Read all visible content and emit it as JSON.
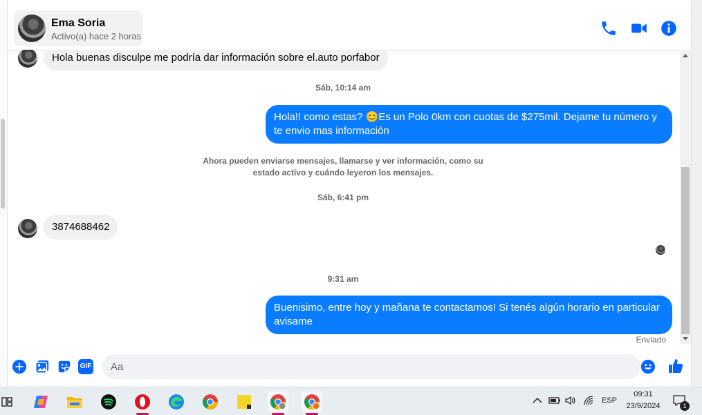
{
  "contact": {
    "name": "Ema Soria",
    "status": "Activo(a) hace 2 horas"
  },
  "messages": {
    "in_1": "Hola buenas disculpe me podría dar información sobre el.auto porfabor",
    "ts_1": "Sáb, 10:14 am",
    "out_1": "Hola!! como estas? 😊Es un Polo 0km con cuotas de $275mil. Dejame tu número y te envio mas información",
    "notice": "Ahora pueden enviarse mensajes, llamarse y ver información, como su estado activo y cuándo leyeron los mensajes.",
    "ts_2": "Sáb, 6:41 pm",
    "in_2": "3874688462",
    "ts_3": "9:31 am",
    "out_2": "Buenisimo, entre hoy y mañana te contactamos! Si tenés algún horario en particular avisame",
    "delivery_status": "Enviado"
  },
  "composer": {
    "placeholder": "Aa",
    "gif_label": "GIF"
  },
  "taskbar": {
    "apps": [
      "task-view",
      "copilot",
      "file-explorer",
      "spotify",
      "opera",
      "edge",
      "chrome",
      "sticky-notes",
      "chrome-profile-1",
      "chrome-profile-2"
    ],
    "language": "ESP",
    "time": "09:31",
    "date": "23/9/2024",
    "notification_count": "1"
  },
  "colors": {
    "accent": "#0a7cff",
    "icon_blue": "#0866ff",
    "incoming_bubble": "#f0f0f0"
  }
}
